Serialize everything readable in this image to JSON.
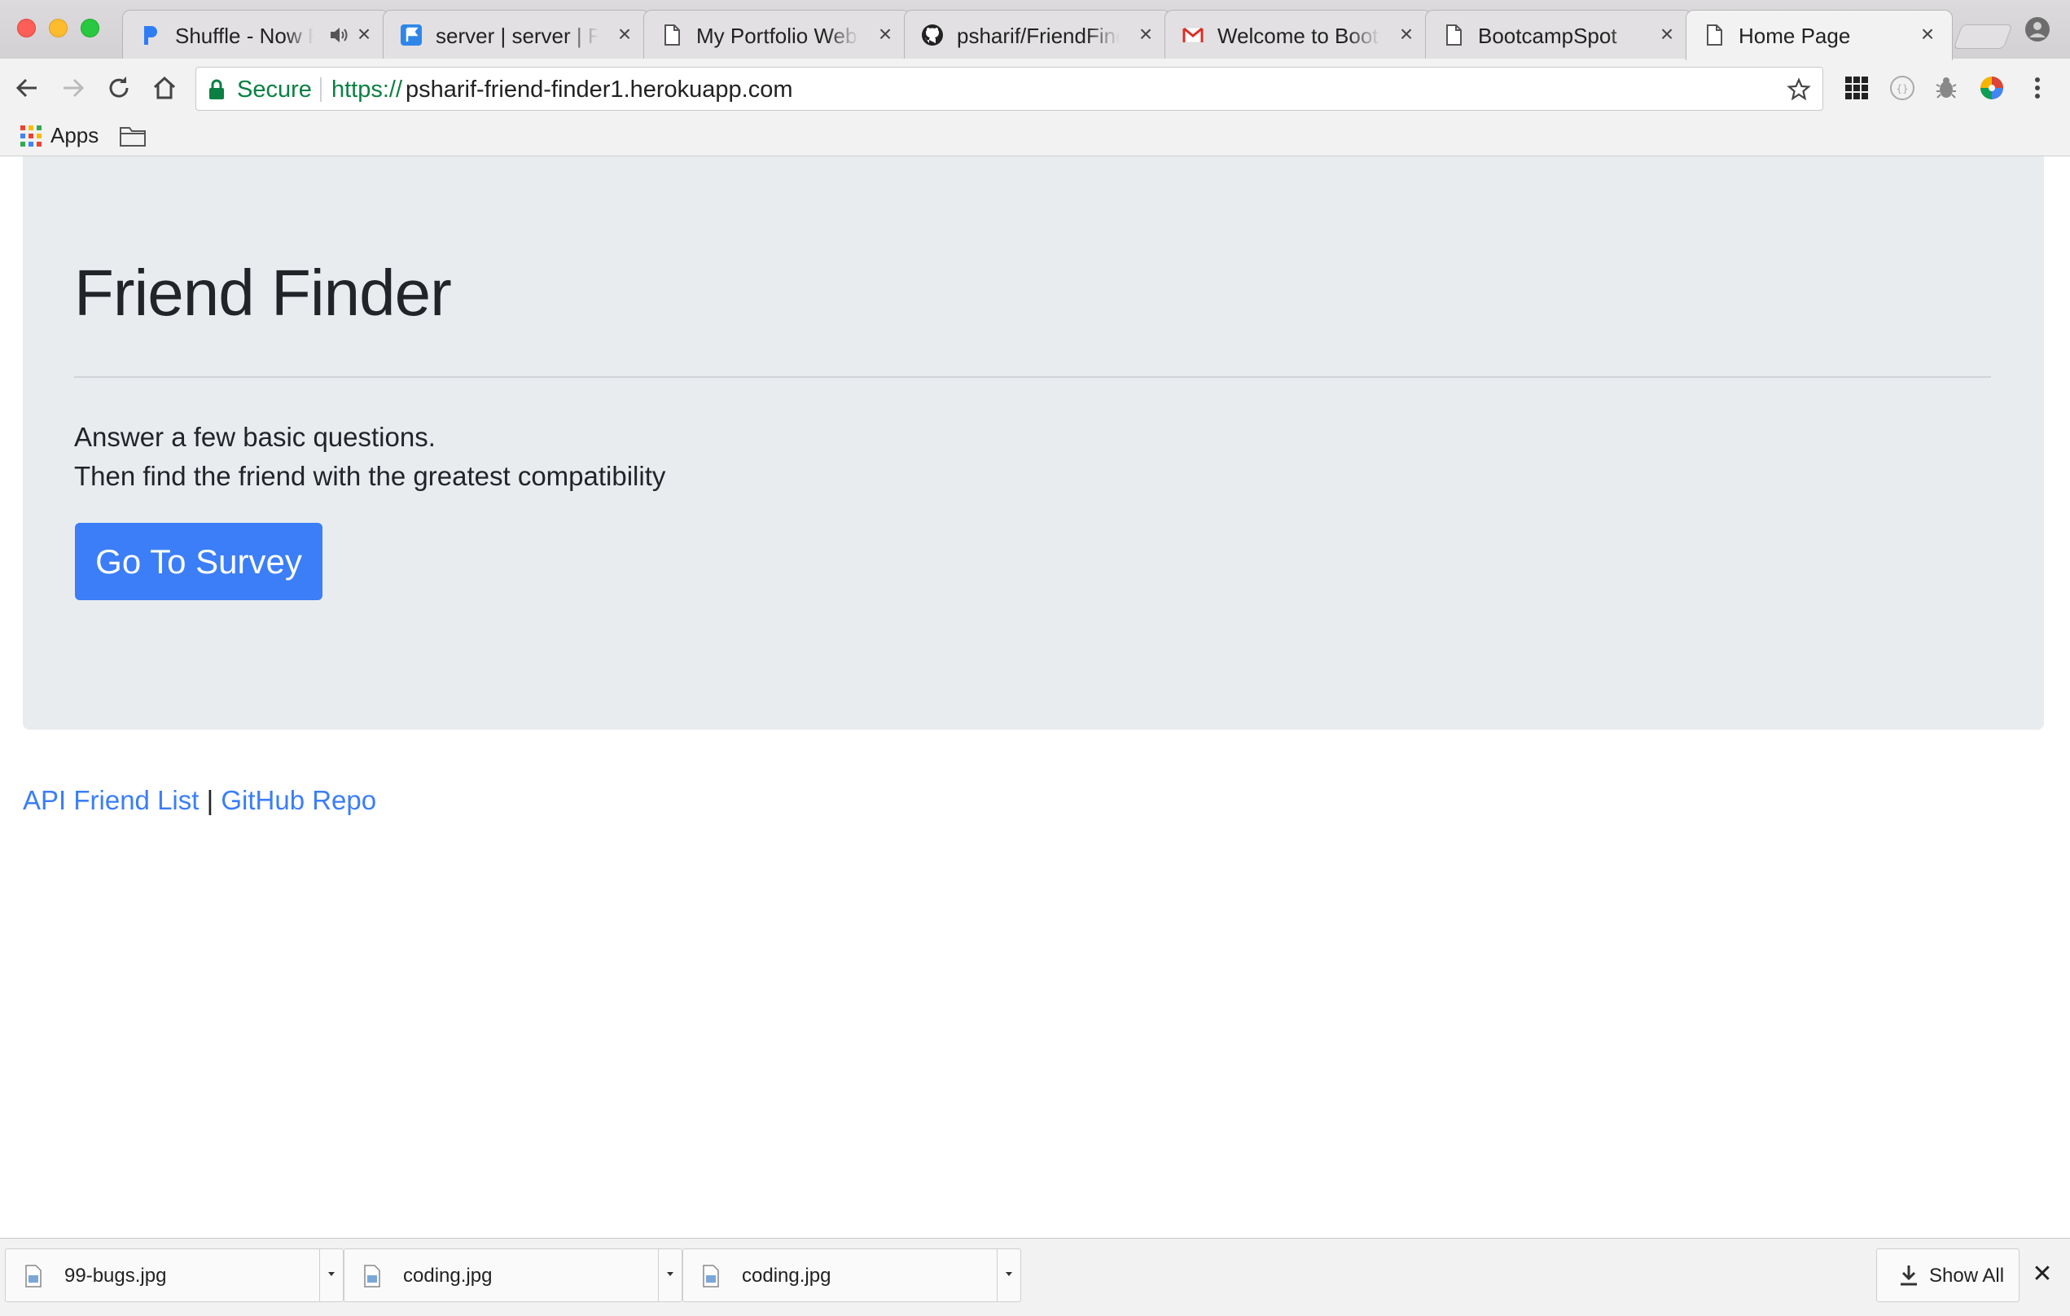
{
  "browser": {
    "tabs": [
      {
        "title": "Shuffle - Now P",
        "icon": "pandora-icon",
        "active": false,
        "audio": true
      },
      {
        "title": "server | server | Fo",
        "icon": "flag-icon",
        "active": false
      },
      {
        "title": "My Portfolio Websi",
        "icon": "page-icon",
        "active": false
      },
      {
        "title": "psharif/FriendFind",
        "icon": "github-icon",
        "active": false
      },
      {
        "title": "Welcome to BootC",
        "icon": "gmail-icon",
        "active": false
      },
      {
        "title": "BootcampSpot",
        "icon": "page-icon",
        "active": false
      },
      {
        "title": "Home Page",
        "icon": "page-icon",
        "active": true
      }
    ],
    "tab_close_glyph": "×",
    "omnibox": {
      "secure_label": "Secure",
      "url_scheme": "https://",
      "url_host": "psharif-friend-finder1.herokuapp.com"
    },
    "bookmarks": {
      "apps_label": "Apps"
    }
  },
  "page": {
    "title": "Friend Finder",
    "lead_line_1": "Answer a few basic questions.",
    "lead_line_2": "Then find the friend with the greatest compatibility",
    "survey_button": "Go To Survey",
    "footer": {
      "link_1": "API Friend List",
      "separator": " | ",
      "link_2": "GitHub Repo"
    }
  },
  "downloads": {
    "items": [
      {
        "name": "99-bugs.jpg"
      },
      {
        "name": "coding.jpg"
      },
      {
        "name": "coding.jpg"
      }
    ],
    "show_all_label": "Show All",
    "close_glyph": "✕"
  },
  "colors": {
    "accent": "#3b7ef7",
    "secure_green": "#0b8043",
    "jumbotron_bg": "#e9ecef"
  }
}
